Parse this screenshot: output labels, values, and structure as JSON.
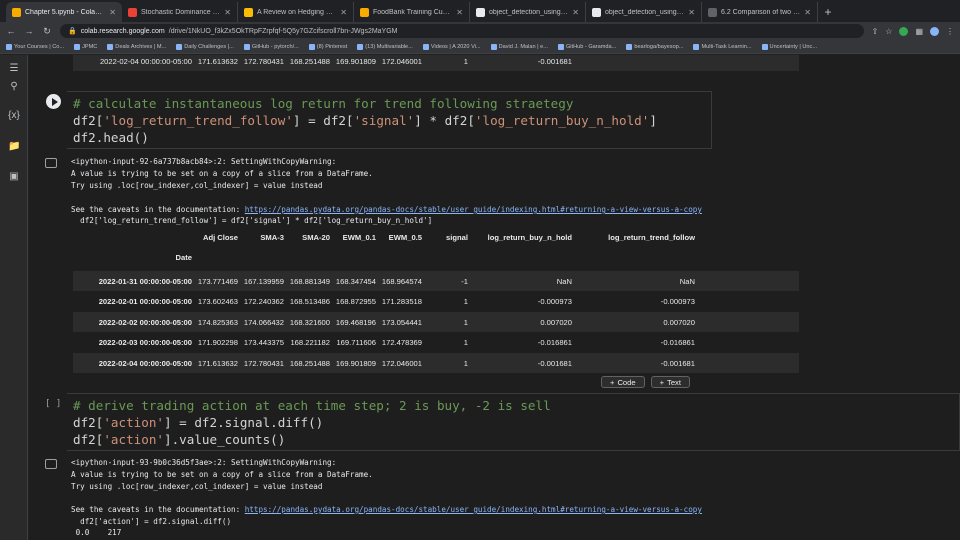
{
  "tabs": [
    {
      "title": "Chapter 5.ipynb - Colaboratory",
      "color": "#f9ab00",
      "active": true
    },
    {
      "title": "Stochastic Dominance & Wasserstein",
      "color": "#ea4335"
    },
    {
      "title": "A Review on Hedging Derivatives",
      "color": "#fbbc04"
    },
    {
      "title": "FoodBank Training Customisation",
      "color": "#f9ab00"
    },
    {
      "title": "object_detection_using_tensorflow",
      "color": "#e8eaed"
    },
    {
      "title": "object_detection_using_tensorflow",
      "color": "#e8eaed"
    },
    {
      "title": "6.2 Comparison of two distributions",
      "color": "#5f6368"
    }
  ],
  "address": {
    "host": "colab.research.google.com",
    "path": "/drive/1NkUO_f3kZx5OkTRpFZrpfqf-5Q5y7GZcifscroll7bn-JWgs2MaYGM"
  },
  "bookmarks": [
    "Your Courses | Co...",
    "JPMC",
    "Deals Archives | M...",
    "Daily Challenges |...",
    "GitHub - pytorch/...",
    "(8) Pinterest",
    "(13) Multivariable...",
    "Videos | A 2020 Vi...",
    "David J. Malan | e...",
    "GitHub - Garamda...",
    "bearloga/bayesop...",
    "Multi-Task Learnin...",
    "Uncertainty | Unc..."
  ],
  "top_partial_row": {
    "date": "2022-02-04 00:00:00-05:00",
    "cells": [
      "171.613632",
      "172.780431",
      "168.251488",
      "169.901809",
      "172.046001",
      "1",
      "-0.001681"
    ]
  },
  "cell1": {
    "comment": "# calculate instantaneous log return for trend following straetegy",
    "line2_a": "df2[",
    "line2_s1": "'log_return_trend_follow'",
    "line2_b": "] = df2[",
    "line2_s2": "'signal'",
    "line2_c": "] * df2[",
    "line2_s3": "'log_return_buy_n_hold'",
    "line2_d": "]",
    "line3": "df2.head()"
  },
  "output1": {
    "warn1": "<ipython-input-92-6a737b8acb84>:2: SettingWithCopyWarning:",
    "warn2": "A value is trying to be set on a copy of a slice from a DataFrame.",
    "warn3": "Try using .loc[row_indexer,col_indexer] = value instead",
    "caveat": "See the caveats in the documentation: ",
    "doc_link": "https://pandas.pydata.org/pandas-docs/stable/user_guide/indexing.html#returning-a-view-versus-a-copy",
    "code_echo": "  df2['log_return_trend_follow'] = df2['signal'] * df2['log_return_buy_n_hold']"
  },
  "table": {
    "columns": [
      "Adj Close",
      "SMA-3",
      "SMA-20",
      "EWM_0.1",
      "EWM_0.5",
      "signal",
      "log_return_buy_n_hold",
      "log_return_trend_follow"
    ],
    "index_name": "Date",
    "rows": [
      {
        "date": "2022-01-31 00:00:00-05:00",
        "cells": [
          "173.771469",
          "167.139959",
          "168.881349",
          "168.347454",
          "168.964574",
          "-1",
          "NaN",
          "NaN"
        ]
      },
      {
        "date": "2022-02-01 00:00:00-05:00",
        "cells": [
          "173.602463",
          "172.240362",
          "168.513486",
          "168.872955",
          "171.283518",
          "1",
          "-0.000973",
          "-0.000973"
        ]
      },
      {
        "date": "2022-02-02 00:00:00-05:00",
        "cells": [
          "174.825363",
          "174.066432",
          "168.321600",
          "169.468196",
          "173.054441",
          "1",
          "0.007020",
          "0.007020"
        ]
      },
      {
        "date": "2022-02-03 00:00:00-05:00",
        "cells": [
          "171.902298",
          "173.443375",
          "168.221182",
          "169.711606",
          "172.478369",
          "1",
          "-0.016861",
          "-0.016861"
        ]
      },
      {
        "date": "2022-02-04 00:00:00-05:00",
        "cells": [
          "171.613632",
          "172.780431",
          "168.251488",
          "169.901809",
          "172.046001",
          "1",
          "-0.001681",
          "-0.001681"
        ]
      }
    ]
  },
  "add_bar": {
    "code": "Code",
    "text": "Text"
  },
  "cell2": {
    "bracket": "[ ]",
    "comment": "# derive trading action at each time step; 2 is buy, -2 is sell",
    "line2_a": "df2[",
    "line2_s1": "'action'",
    "line2_b": "] = df2.signal.diff()",
    "line3_a": "df2[",
    "line3_s1": "'action'",
    "line3_b": "].value_counts()"
  },
  "output2": {
    "warn1": "<ipython-input-93-9b0c36d5f3ae>:2: SettingWithCopyWarning:",
    "warn2": "A value is trying to be set on a copy of a slice from a DataFrame.",
    "warn3": "Try using .loc[row_indexer,col_indexer] = value instead",
    "caveat": "See the caveats in the documentation: ",
    "doc_link": "https://pandas.pydata.org/pandas-docs/stable/user_guide/indexing.html#returning-a-view-versus-a-copy",
    "code_echo": "  df2['action'] = df2.signal.diff()",
    "last_line": " 0.0    217"
  }
}
